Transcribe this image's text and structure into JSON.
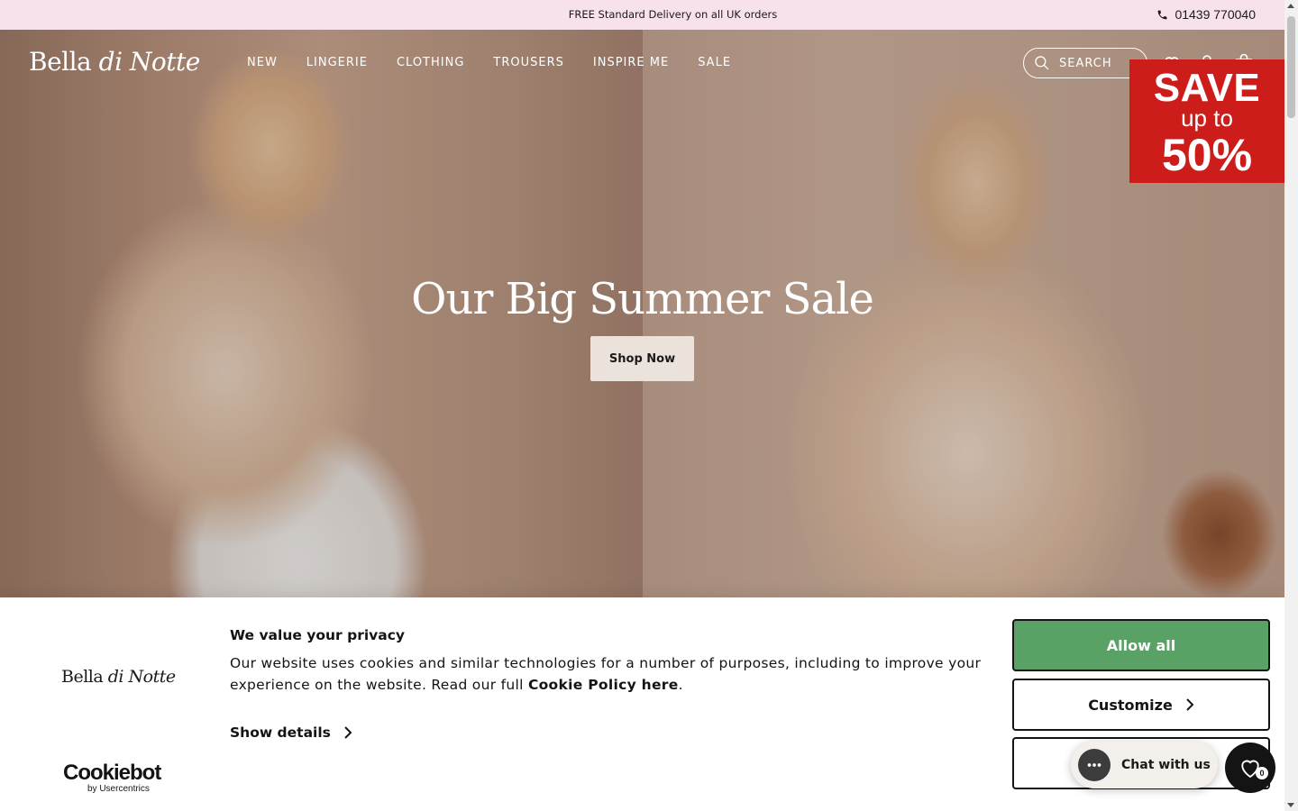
{
  "promo": {
    "text": "FREE Standard Delivery on all UK orders",
    "phone": "01439 770040"
  },
  "header": {
    "logo_main": "Bella ",
    "logo_italic": "di Notte",
    "nav": [
      "NEW",
      "LINGERIE",
      "CLOTHING",
      "TROUSERS",
      "INSPIRE ME",
      "SALE"
    ],
    "search_placeholder": "SEARCH",
    "icons": [
      "heart-icon",
      "user-icon",
      "bag-icon"
    ]
  },
  "sale_badge": {
    "line1": "SAVE",
    "line2": "up to",
    "line3": "50%",
    "color": "#cc1d1b"
  },
  "hero": {
    "title": "Our Big Summer Sale",
    "button": "Shop Now"
  },
  "cookie": {
    "logo_main": "Bella ",
    "logo_italic": "di Notte",
    "title": "We value your privacy",
    "body_pre": "Our website uses cookies and similar technologies for a number of purposes, including to improve your experience on the website. Read our full ",
    "body_link": "Cookie Policy here",
    "body_post": ".",
    "show_details": "Show details",
    "allow_all": "Allow all",
    "customize": "Customize",
    "cookiebot_brand": "Cookiebot",
    "cookiebot_by": "by Usercentrics",
    "allow_color": "#5aa166"
  },
  "chat": {
    "label": "Chat with us"
  },
  "wishlist": {
    "count": "0"
  }
}
